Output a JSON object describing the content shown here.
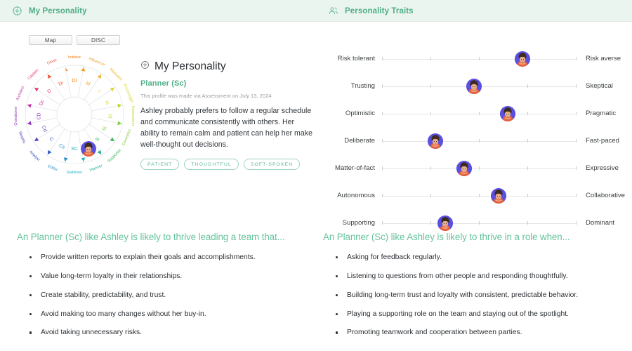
{
  "header": {
    "tabs": [
      {
        "label": "My Personality",
        "icon": "target-crosshair-icon"
      },
      {
        "label": "Personality Traits",
        "icon": "people-group-icon"
      }
    ]
  },
  "wheel": {
    "toggles": [
      {
        "label": "Map",
        "active": true
      },
      {
        "label": "DISC",
        "active": false
      }
    ],
    "segments": [
      {
        "code": "DI",
        "name": "Initiator",
        "color": "#f4821f"
      },
      {
        "code": "Id",
        "name": "Influencer",
        "color": "#f59d22"
      },
      {
        "code": "I",
        "name": "Motivator",
        "color": "#f2b630"
      },
      {
        "code": "Is",
        "name": "Encourager",
        "color": "#d9d42e"
      },
      {
        "code": "IS",
        "name": "Harmonizer",
        "color": "#b9d62c"
      },
      {
        "code": "Si",
        "name": "Counselor",
        "color": "#86cc3f"
      },
      {
        "code": "S",
        "name": "Supporter",
        "color": "#35b75b"
      },
      {
        "code": "Sc",
        "name": "Planner",
        "color": "#25b28e"
      },
      {
        "code": "SC",
        "name": "Stabilizer",
        "color": "#2cb5c6"
      },
      {
        "code": "Cs",
        "name": "Editor",
        "color": "#2a8fd0"
      },
      {
        "code": "C",
        "name": "Analyst",
        "color": "#2f56c0"
      },
      {
        "code": "Cd",
        "name": "Skeptic",
        "color": "#5b3fbb"
      },
      {
        "code": "CD",
        "name": "Questioner",
        "color": "#8e38bc"
      },
      {
        "code": "Dc",
        "name": "Architect",
        "color": "#c03aa0"
      },
      {
        "code": "D",
        "name": "Captain",
        "color": "#e03b72"
      },
      {
        "code": "Di",
        "name": "Driver",
        "color": "#ee5b3c"
      }
    ],
    "user_position": {
      "segment": "Sc",
      "ring": 0.62
    }
  },
  "profile": {
    "title": "My Personality",
    "title_icon": "plus-circle-icon",
    "type": "Planner (Sc)",
    "meta": "This profile was made via Assessment on July 13, 2024",
    "description": "Ashley probably prefers to follow a regular schedule and communicate consistently with others. Her ability to remain calm and patient can help her make well-thought out decisions.",
    "tags": [
      "PATIENT",
      "THOUGHTFUL",
      "SOFT-SPOKEN"
    ]
  },
  "traits": {
    "tick_count": 5,
    "rows": [
      {
        "left": "Risk tolerant",
        "right": "Risk averse",
        "value": 3.9
      },
      {
        "left": "Trusting",
        "right": "Skeptical",
        "value": 2.9
      },
      {
        "left": "Optimistic",
        "right": "Pragmatic",
        "value": 3.6
      },
      {
        "left": "Deliberate",
        "right": "Fast-paced",
        "value": 2.1
      },
      {
        "left": "Matter-of-fact",
        "right": "Expressive",
        "value": 2.7
      },
      {
        "left": "Autonomous",
        "right": "Collaborative",
        "value": 3.4
      },
      {
        "left": "Supporting",
        "right": "Dominant",
        "value": 2.3
      }
    ]
  },
  "bottom": {
    "left": {
      "title": "An Planner (Sc) like Ashley is likely to thrive leading a team that...",
      "items": [
        "Provide written reports to explain their goals and accomplishments.",
        "Value long-term loyalty in their relationships.",
        "Create stability, predictability, and trust.",
        "Avoid making too many changes without her buy-in.",
        "Avoid taking unnecessary risks."
      ]
    },
    "right": {
      "title": "An Planner (Sc) like Ashley is likely to thrive in a role when...",
      "items": [
        "Asking for feedback regularly.",
        "Listening to questions from other people and responding thoughtfully.",
        "Building long-term trust and loyalty with consistent, predictable behavior.",
        "Playing a supporting role on the team and staying out of the spotlight.",
        "Promoting teamwork and cooperation between parties."
      ]
    }
  },
  "colors": {
    "accent": "#4fae86",
    "header_bg": "#eaf5ef",
    "title_green": "#67c39c",
    "marker_bg": "#5b4fe0"
  }
}
